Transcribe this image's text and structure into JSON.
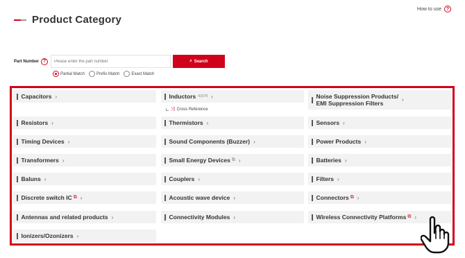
{
  "header": {
    "howto_label": "How to use",
    "howto_icon": "?",
    "title": "Product Category"
  },
  "search": {
    "label": "Part Number",
    "help_icon": "?",
    "placeholder": "Please enter the part number",
    "button_label": "Search",
    "button_icon": "⌕",
    "options": [
      "Partial Match",
      "Prefix Match",
      "Exact Match"
    ],
    "selected": "Partial Match"
  },
  "categories": {
    "capacitors": "Capacitors",
    "inductors": "Inductors",
    "inductors_badge": "43378",
    "inductors_xref": "Cross Reference",
    "noise_line1": "Noise Suppression Products/",
    "noise_line2": "EMI Suppression Filters",
    "resistors": "Resistors",
    "thermistors": "Thermistors",
    "sensors": "Sensors",
    "timing": "Timing Devices",
    "sound": "Sound Components (Buzzer)",
    "power": "Power Products",
    "transformers": "Transformers",
    "small_energy": "Small Energy Devices",
    "batteries": "Batteries",
    "baluns": "Baluns",
    "couplers": "Couplers",
    "filters": "Filters",
    "discrete": "Discrete switch IC",
    "acoustic": "Acoustic wave device",
    "connectors": "Connectors",
    "antennas": "Antennas and related products",
    "connectivity": "Connectivity Modules",
    "wireless": "Wireless Connectivity Platforms",
    "ionizers": "Ionizers/Ozonizers"
  },
  "colors": {
    "accent": "#d0021b",
    "cell_bg": "#f2f2f2"
  },
  "icons": {
    "chevron": "›",
    "external": "⧉",
    "shuffle": "⤨"
  }
}
